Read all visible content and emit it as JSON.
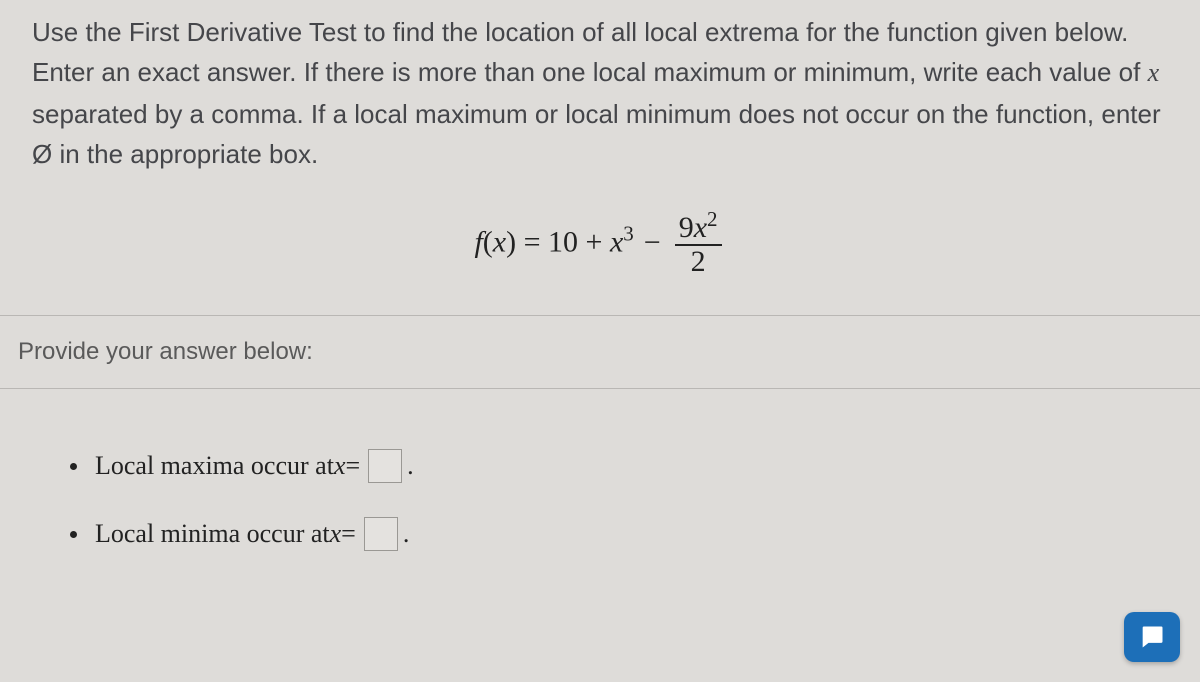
{
  "question": {
    "line1_pre": "Use the First Derivative Test to find the location of all local extrema for the function given below. Enter an exact answer. If there is more than one local maximum or minimum, write each value of ",
    "var": "x",
    "line1_mid": " separated by a comma. If a local maximum or local minimum does not occur on the function, enter ",
    "null": "Ø",
    "line1_post": " in the appropriate box."
  },
  "formula": {
    "lhs_f": "f",
    "lhs_open": "(",
    "lhs_var": "x",
    "lhs_close": ") = ",
    "term1_coeff": "10 + ",
    "term1_var": "x",
    "term1_exp": "3",
    "minus": "−",
    "frac_num_coeff": "9",
    "frac_num_var": "x",
    "frac_num_exp": "2",
    "frac_den": "2"
  },
  "section_label": "Provide your answer below:",
  "answers": {
    "maxima_label_pre": "Local maxima occur at ",
    "maxima_var": "x",
    "maxima_eq": " = ",
    "minima_label_pre": "Local minima occur at ",
    "minima_var": "x",
    "minima_eq": " = ",
    "period": "."
  },
  "inputs": {
    "maxima_value": "",
    "minima_value": ""
  }
}
